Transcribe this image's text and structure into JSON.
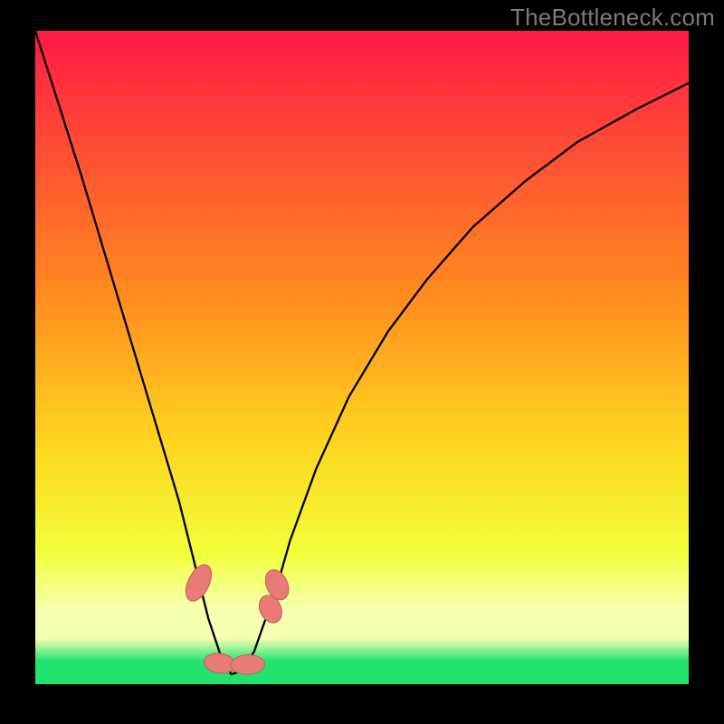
{
  "watermark": "TheBottleneck.com",
  "colors": {
    "bg": "#000000",
    "grad_top": "#ff1a46",
    "grad_mid1": "#ff8a1f",
    "grad_mid2": "#ffd21f",
    "grad_mid3": "#f2ff3a",
    "grad_band": "#f6ffb0",
    "grad_bottom": "#1fe36e",
    "curve": "#000000",
    "marker_fill": "#e87a77",
    "marker_stroke": "#c9605d"
  },
  "chart_data": {
    "type": "line",
    "title": "",
    "xlabel": "",
    "ylabel": "",
    "xlim": [
      0,
      100
    ],
    "ylim": [
      0,
      100
    ],
    "series": [
      {
        "name": "bottleneck-curve",
        "x": [
          0,
          3.5,
          7,
          10,
          13,
          16,
          19,
          22,
          24.5,
          26.5,
          28.5,
          30,
          31.5,
          33.5,
          37,
          39,
          43,
          48,
          54,
          60,
          67,
          75,
          83,
          92,
          100
        ],
        "y": [
          100,
          89,
          78,
          68,
          58,
          48,
          38,
          28,
          18,
          10,
          4,
          1.5,
          2,
          5,
          15,
          22,
          33,
          44,
          54,
          62,
          70,
          77,
          83,
          88,
          92
        ]
      }
    ],
    "markers": [
      {
        "name": "marker-left",
        "cx": 25.0,
        "cy": 15.5,
        "rx": 1.6,
        "ry": 3.0,
        "rot": 26
      },
      {
        "name": "marker-min-a",
        "cx": 28.2,
        "cy": 3.2,
        "rx": 2.4,
        "ry": 1.5,
        "rot": 8
      },
      {
        "name": "marker-min-b",
        "cx": 32.5,
        "cy": 3.0,
        "rx": 2.6,
        "ry": 1.5,
        "rot": -2
      },
      {
        "name": "marker-right-a",
        "cx": 36.0,
        "cy": 11.5,
        "rx": 1.6,
        "ry": 2.2,
        "rot": -26
      },
      {
        "name": "marker-right-b",
        "cx": 37.0,
        "cy": 15.2,
        "rx": 1.6,
        "ry": 2.4,
        "rot": -24
      }
    ],
    "gradient_stops": [
      {
        "offset": 0.0,
        "color_key": "grad_top"
      },
      {
        "offset": 0.4,
        "color_key": "grad_mid1"
      },
      {
        "offset": 0.62,
        "color_key": "grad_mid2"
      },
      {
        "offset": 0.8,
        "color_key": "grad_mid3"
      },
      {
        "offset": 0.885,
        "color_key": "grad_band"
      },
      {
        "offset": 0.93,
        "color_key": "grad_band"
      },
      {
        "offset": 0.965,
        "color_key": "grad_bottom"
      },
      {
        "offset": 1.0,
        "color_key": "grad_bottom"
      }
    ]
  }
}
